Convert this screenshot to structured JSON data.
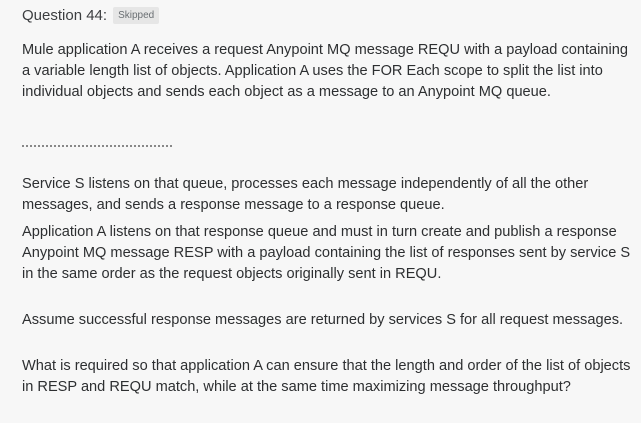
{
  "question": {
    "title": "Question 44:",
    "status": "Skipped"
  },
  "paragraphs": [
    "Mule application A receives a request Anypoint MQ message REQU with a payload containing a variable length list of objects. Application A uses the FOR Each scope to split the list into individual objects and sends each object as a message to an Anypoint MQ queue.",
    "Service S listens on that queue, processes each message independently of all the other messages, and sends a response message to a response queue.",
    "Application A listens on that response queue and must in turn create and publish a response Anypoint MQ message RESP with a payload containing the list of responses sent by service S in the same order as the request objects originally sent in REQU.",
    "Assume successful response messages are returned by services S for all request messages.",
    "What is required so that application A can ensure that the length and order of the list of objects in RESP and REQU match, while at the same time maximizing message throughput?"
  ]
}
